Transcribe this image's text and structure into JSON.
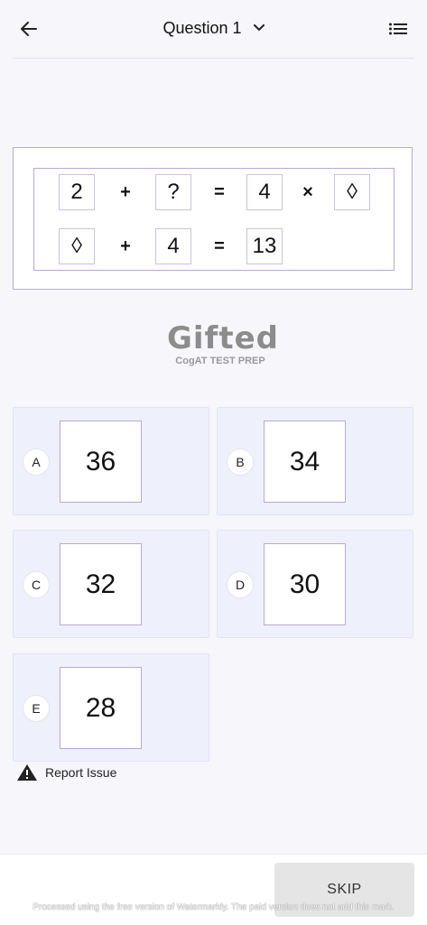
{
  "header": {
    "title": "Question 1",
    "icons": {
      "back": "arrow-left-icon",
      "dropdown": "chevron-down-icon",
      "list": "list-icon"
    }
  },
  "puzzle": {
    "row1": {
      "a": "2",
      "op1": "+",
      "b": "?",
      "eq": "=",
      "c": "4",
      "op2": "×",
      "d": "◊"
    },
    "row2": {
      "a": "◊",
      "op1": "+",
      "b": "4",
      "eq": "=",
      "c": "13"
    }
  },
  "logo": {
    "main": "Gifted",
    "sub": "CogAT TEST PREP"
  },
  "options": [
    {
      "letter": "A",
      "value": "36"
    },
    {
      "letter": "B",
      "value": "34"
    },
    {
      "letter": "C",
      "value": "32"
    },
    {
      "letter": "D",
      "value": "30"
    },
    {
      "letter": "E",
      "value": "28"
    }
  ],
  "report": {
    "label": "Report Issue",
    "icon": "warning-icon"
  },
  "footer": {
    "skip_label": "SKIP"
  },
  "watermark": "Processed using the free version of Watermarkly. The paid version does not add this mark.",
  "colors": {
    "background": "#f6f6fb",
    "option_bg": "#eef0fc",
    "accent_border": "#b9a8dd",
    "skip_bg": "#e5e5e5"
  }
}
